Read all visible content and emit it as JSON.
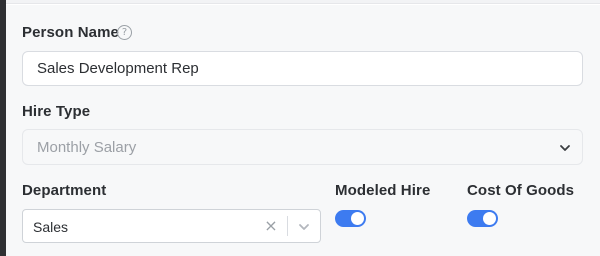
{
  "form": {
    "person_name": {
      "label": "Person Name",
      "help_icon": "question-circle-icon",
      "value": "Sales Development Rep"
    },
    "hire_type": {
      "label": "Hire Type",
      "value": "Monthly Salary",
      "chevron_icon": "chevron-down-icon"
    },
    "department": {
      "label": "Department",
      "value": "Sales",
      "clear_icon": "clear-x-icon",
      "chevron_icon": "chevron-down-icon"
    },
    "modeled_hire": {
      "label": "Modeled Hire",
      "enabled": true
    },
    "cost_of_goods": {
      "label": "Cost Of Goods",
      "enabled": true
    }
  },
  "colors": {
    "toggle_on": "#3d7bf0",
    "panel_bg": "#f7f8f9",
    "text": "#2c2f33",
    "placeholder_text": "#9ca0a6"
  }
}
